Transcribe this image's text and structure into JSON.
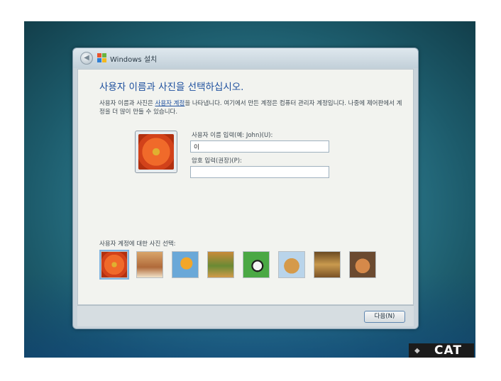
{
  "window": {
    "title": "Windows 설치",
    "back_glyph": "◀"
  },
  "content": {
    "heading": "사용자 이름과 사진을 선택하십시오.",
    "desc_before_link": "사용자 이름과 사진은 ",
    "desc_link": "사용자 계정",
    "desc_after_link": "을 나타냅니다. 여기에서 만든 계정은 컴퓨터 관리자 계정입니다. 나중에 제어판에서 계정을 더 많이 만들 수 있습니다.",
    "username_label": "사용자 이름 입력(예: John)(U):",
    "username_value": "이",
    "password_label": "암호 입력(권장)(P):",
    "password_value": "",
    "picture_label": "사용자 계정에 대한 사진 선택:",
    "pictures": [
      {
        "name": "flower",
        "selected": true
      },
      {
        "name": "robot"
      },
      {
        "name": "fish"
      },
      {
        "name": "chameleon"
      },
      {
        "name": "soccer-ball"
      },
      {
        "name": "dog"
      },
      {
        "name": "chess"
      },
      {
        "name": "cat"
      }
    ]
  },
  "footer": {
    "next_label": "다음(N)"
  },
  "watermark": {
    "text": "CAT"
  },
  "colors": {
    "accent": "#1d4f9e",
    "window_bg": "#f2f3ef",
    "desktop": "#2f7f93"
  },
  "icons": {
    "back": "back-arrow-icon",
    "windows": "windows-logo-icon"
  }
}
